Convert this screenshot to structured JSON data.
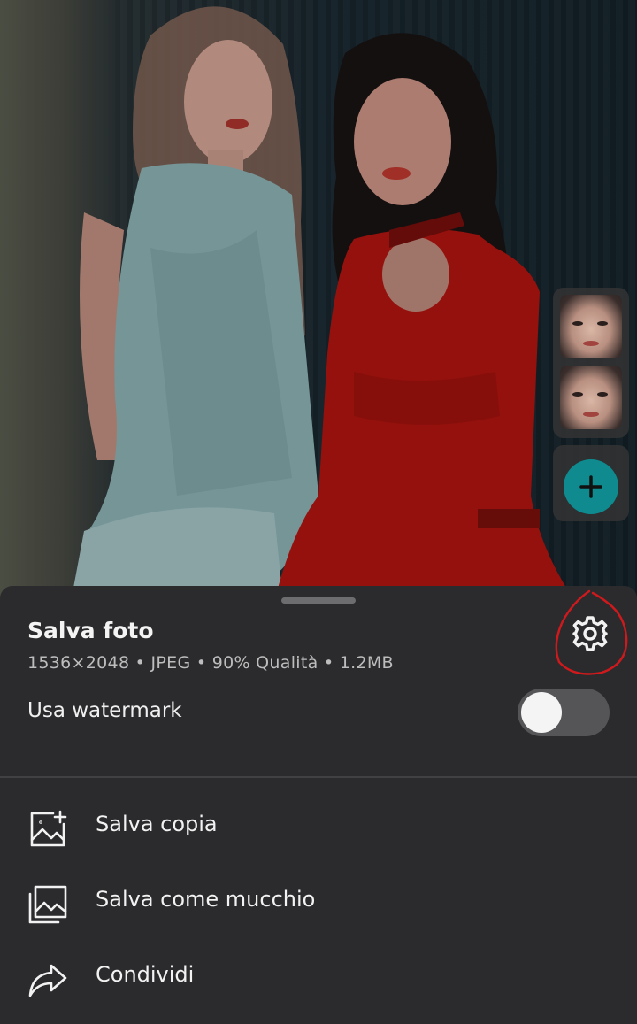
{
  "photo": {
    "icon": "photo-preview"
  },
  "faces": {
    "items": [
      "face-thumbnail",
      "face-thumbnail"
    ],
    "add_icon": "plus-icon",
    "accent": "#0f8a8f"
  },
  "sheet": {
    "title": "Salva foto",
    "meta": "1536×2048 • JPEG • 90% Qualità • 1.2MB",
    "settings_icon": "gear-icon",
    "watermark": {
      "label": "Usa watermark",
      "enabled": false
    },
    "actions": [
      {
        "label": "Salva copia",
        "icon": "image-add-icon"
      },
      {
        "label": "Salva come mucchio",
        "icon": "image-stack-icon"
      },
      {
        "label": "Condividi",
        "icon": "share-icon"
      }
    ]
  }
}
